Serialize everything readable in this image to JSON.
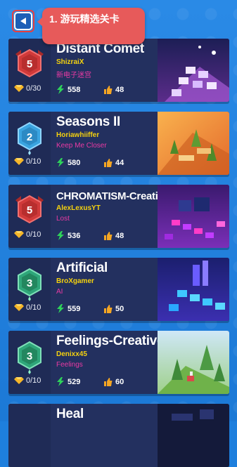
{
  "tooltip": {
    "text": "1. 游玩精选关卡"
  },
  "back_button": {
    "icon": "back-arrow-icon"
  },
  "levels": [
    {
      "title": "Distant Comet",
      "author": "ShizraiX",
      "subtitle": "新电子迷宫",
      "badge_level": "5",
      "gems": "0/30",
      "plays": "558",
      "likes": "48",
      "badge_color": "#d13a3a"
    },
    {
      "title": "Seasons II",
      "author": "Horiawhiiffer",
      "subtitle": "Keep Me Closer",
      "badge_level": "2",
      "gems": "0/10",
      "plays": "580",
      "likes": "44",
      "badge_color": "#3aa4e0"
    },
    {
      "title": "CHROMATISM-Creative",
      "author": "AlexLexusYT",
      "subtitle": "Lost",
      "badge_level": "5",
      "gems": "0/10",
      "plays": "536",
      "likes": "48",
      "badge_color": "#d13a3a"
    },
    {
      "title": "Artificial",
      "author": "BroXgamer",
      "subtitle": "AI",
      "badge_level": "3",
      "gems": "0/10",
      "plays": "559",
      "likes": "50",
      "badge_color": "#2fa67a"
    },
    {
      "title": "Feelings-Creative",
      "author": "Denixx45",
      "subtitle": "Feelings",
      "badge_level": "3",
      "gems": "0/10",
      "plays": "529",
      "likes": "60",
      "badge_color": "#2fa67a"
    },
    {
      "title": "Heal"
    }
  ]
}
